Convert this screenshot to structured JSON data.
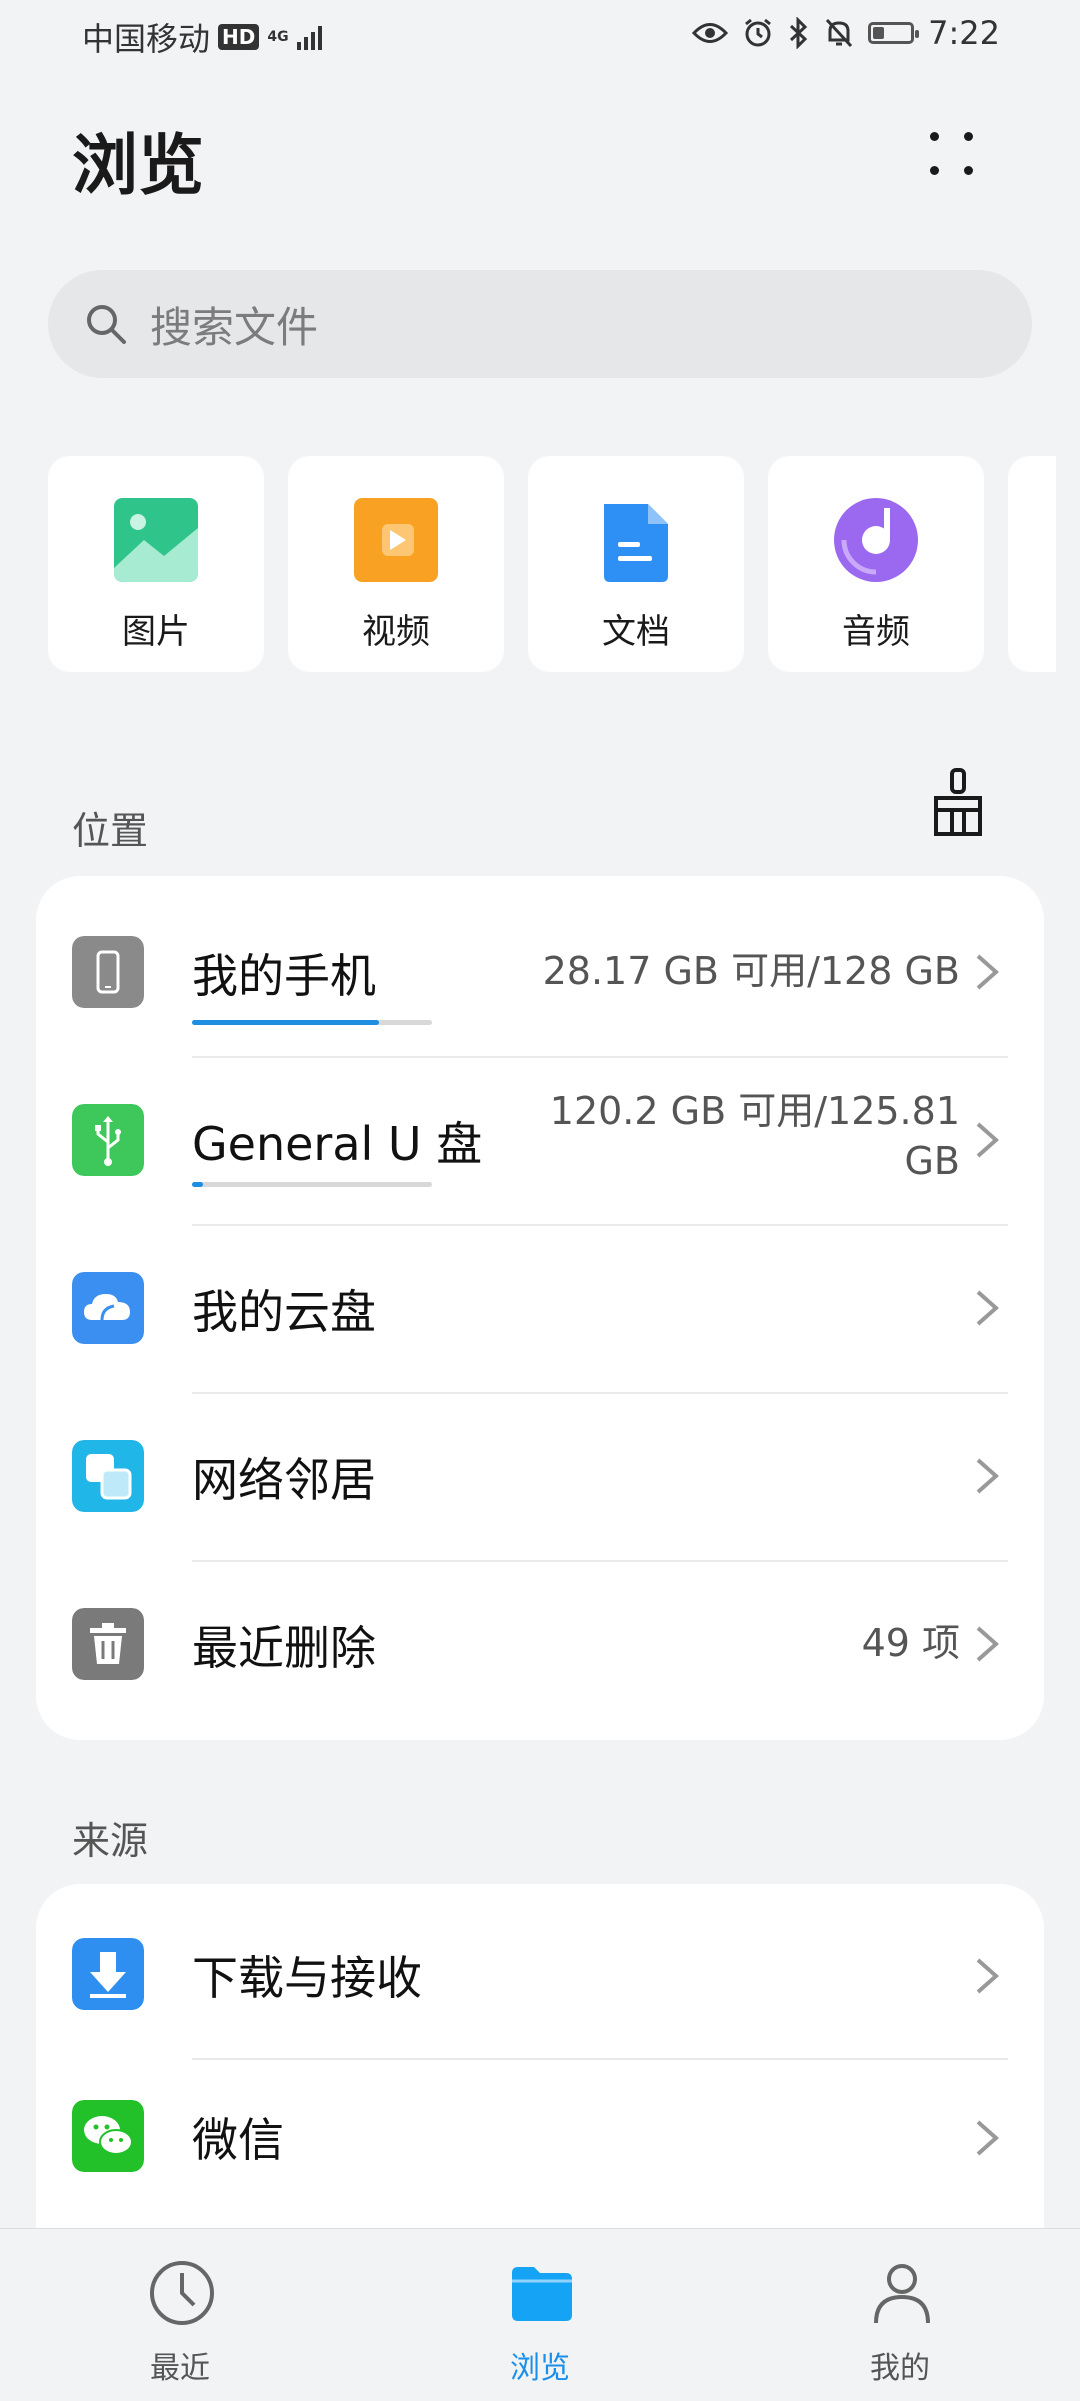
{
  "status_bar": {
    "carrier": "中国移动",
    "hd": "HD",
    "network": "4G",
    "time": "7:22",
    "battery_level": 0.3
  },
  "header": {
    "title": "浏览"
  },
  "search": {
    "placeholder": "搜索文件"
  },
  "categories": [
    {
      "label": "图片",
      "icon": "image-icon",
      "color": "#2fc48a"
    },
    {
      "label": "视频",
      "icon": "video-icon",
      "color": "#f9a122"
    },
    {
      "label": "文档",
      "icon": "document-icon",
      "color": "#2e8ff5"
    },
    {
      "label": "音频",
      "icon": "audio-icon",
      "color": "#9b68f0"
    }
  ],
  "locations": {
    "title": "位置",
    "items": [
      {
        "title": "我的手机",
        "info": "28.17 GB 可用/128 GB",
        "icon": "phone-icon",
        "color": "#8a8a8a",
        "used_fraction": 0.78
      },
      {
        "title": "General U 盘",
        "info": "120.2 GB 可用/125.81 GB",
        "icon": "usb-icon",
        "color": "#3ec75a",
        "used_fraction": 0.045
      },
      {
        "title": "我的云盘",
        "info": "",
        "icon": "cloud-icon",
        "color": "#3a8ff0"
      },
      {
        "title": "网络邻居",
        "info": "",
        "icon": "network-icon",
        "color": "#21b6e8"
      },
      {
        "title": "最近删除",
        "info": "49 项",
        "icon": "trash-icon",
        "color": "#7a7a7a"
      }
    ]
  },
  "sources": {
    "title": "来源",
    "items": [
      {
        "title": "下载与接收",
        "icon": "download-icon",
        "color": "#2f8ff0"
      },
      {
        "title": "微信",
        "icon": "wechat-icon",
        "color": "#22c12a"
      }
    ]
  },
  "tabs": [
    {
      "label": "最近",
      "icon": "clock-icon",
      "active": false
    },
    {
      "label": "浏览",
      "icon": "folder-icon",
      "active": true
    },
    {
      "label": "我的",
      "icon": "person-icon",
      "active": false
    }
  ],
  "accent_color": "#1a8ee8"
}
